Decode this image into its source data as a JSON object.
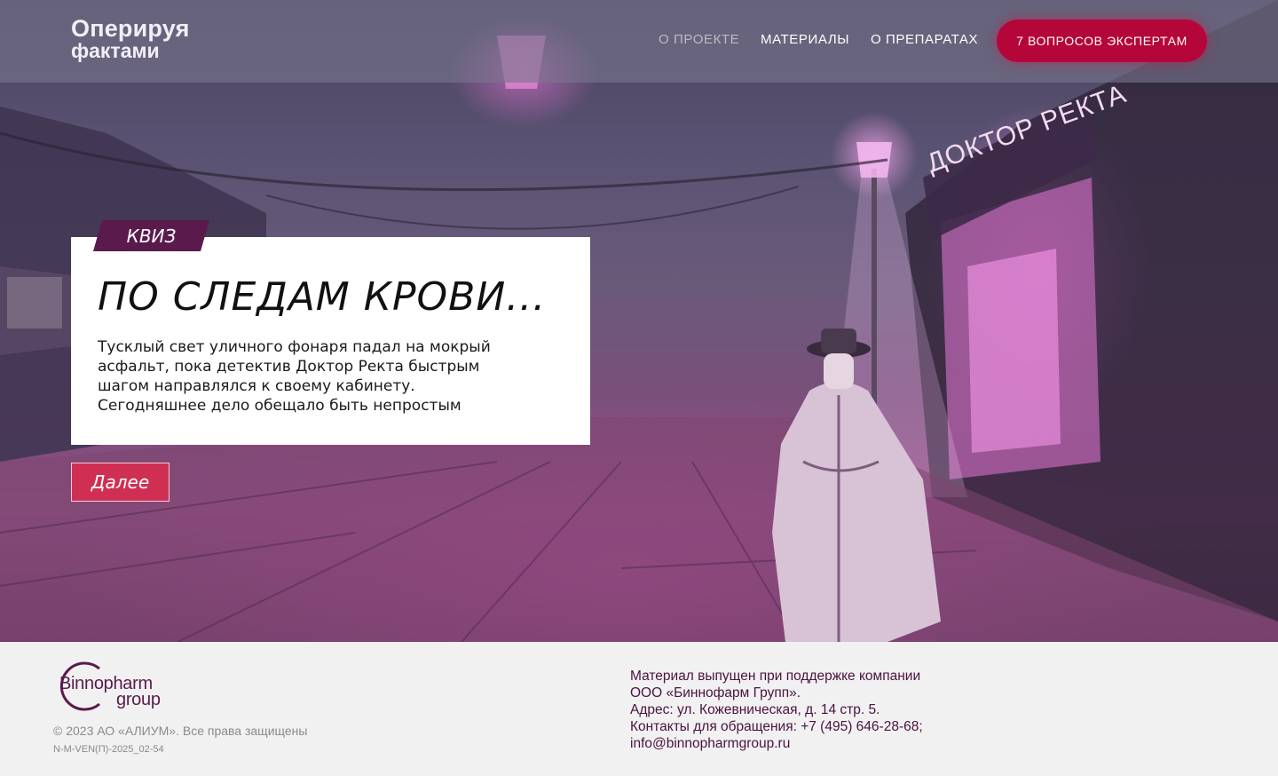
{
  "header": {
    "logo_line1": "Оперируя",
    "logo_line2": "фактами",
    "nav": [
      {
        "label": "О ПРОЕКТЕ",
        "active": false
      },
      {
        "label": "МАТЕРИАЛЫ",
        "active": true
      },
      {
        "label": "О ПРЕПАРАТАХ",
        "active": true
      }
    ],
    "cta_label": "7 ВОПРОСОВ ЭКСПЕРТАМ"
  },
  "hero": {
    "sign_text": "ДОКТОР РЕКТА",
    "tag": "КВИЗ",
    "title": "ПО СЛЕДАМ КРОВИ...",
    "text": "Тусклый свет уличного фонаря падал на мокрый асфальт, пока детектив Доктор Ректа быстрым шагом направлялся к своему кабинету. Сегодняшнее дело обещало быть непростым",
    "next_label": "Далее"
  },
  "footer": {
    "brand_line1": "Binnopharm",
    "brand_line2": "group",
    "copyright": "© 2023 АО «АЛИУМ». Все права защищены",
    "code": "N-M-VEN(П)-2025_02-54",
    "sponsor_lines": [
      "Материал выпущен при поддержке компании",
      "ООО «Биннофарм Групп».",
      "Адрес: ул. Кожевническая, д. 14 стр. 5.",
      "Контакты для обращения: +7 (495) 646-28-68;",
      "info@binnopharmgroup.ru"
    ]
  },
  "colors": {
    "accent": "#b5063a",
    "tag_bg": "#5a1a4c",
    "button_bg": "#d02f54",
    "footer_text": "#4b1340"
  }
}
